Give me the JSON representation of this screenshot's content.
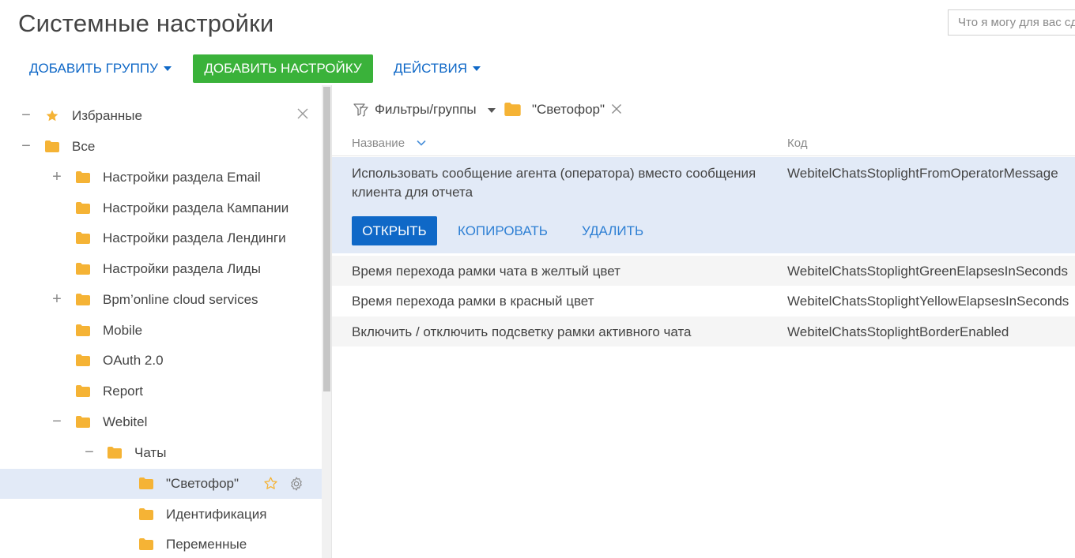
{
  "header": {
    "title": "Системные настройки",
    "search_placeholder": "Что я могу для вас сделать?"
  },
  "toolbar": {
    "add_group": "ДОБАВИТЬ ГРУППУ",
    "add_setting": "ДОБАВИТЬ НАСТРОЙКУ",
    "actions": "ДЕЙСТВИЯ"
  },
  "tree": {
    "favorites": "Избранные",
    "all": "Все",
    "items": [
      {
        "label": "Настройки раздела Email",
        "toggle": "+"
      },
      {
        "label": "Настройки раздела Кампании",
        "toggle": ""
      },
      {
        "label": "Настройки раздела Лендинги",
        "toggle": ""
      },
      {
        "label": "Настройки раздела Лиды",
        "toggle": ""
      },
      {
        "label": "Bpm’online cloud services",
        "toggle": "+"
      },
      {
        "label": "Mobile",
        "toggle": ""
      },
      {
        "label": "OAuth 2.0",
        "toggle": ""
      },
      {
        "label": "Report",
        "toggle": ""
      },
      {
        "label": "Webitel",
        "toggle": "−"
      }
    ],
    "chats": "Чаты",
    "chat_children": [
      {
        "label": "\"Светофор\"",
        "selected": true
      },
      {
        "label": "Идентификация",
        "selected": false
      },
      {
        "label": "Переменные",
        "selected": false
      }
    ]
  },
  "filter": {
    "label": "Фильтры/группы",
    "tag": "\"Светофор\""
  },
  "grid": {
    "columns": {
      "name": "Название",
      "code": "Код"
    },
    "active_row": {
      "name": "Использовать сообщение агента (оператора) вместо сообщения клиента для отчета",
      "code": "WebitelChatsStoplightFromOperatorMessage",
      "open": "ОТКРЫТЬ",
      "copy": "КОПИРОВАТЬ",
      "delete": "УДАЛИТЬ"
    },
    "rows": [
      {
        "name": "Время перехода рамки чата в желтый цвет",
        "code": "WebitelChatsStoplightGreenElapsesInSeconds"
      },
      {
        "name": "Время перехода рамки в красный цвет",
        "code": "WebitelChatsStoplightYellowElapsesInSeconds"
      },
      {
        "name": "Включить / отключить подсветку рамки активного чата",
        "code": "WebitelChatsStoplightBorderEnabled"
      }
    ]
  },
  "colors": {
    "accent_blue": "#0f68c7",
    "green": "#3ab23a",
    "folder": "#f5b335",
    "selected_bg": "#e2eaf7"
  },
  "icons": [
    "star-icon",
    "folder-icon",
    "close-icon",
    "gear-icon",
    "filter-icon",
    "sort-down-icon"
  ]
}
